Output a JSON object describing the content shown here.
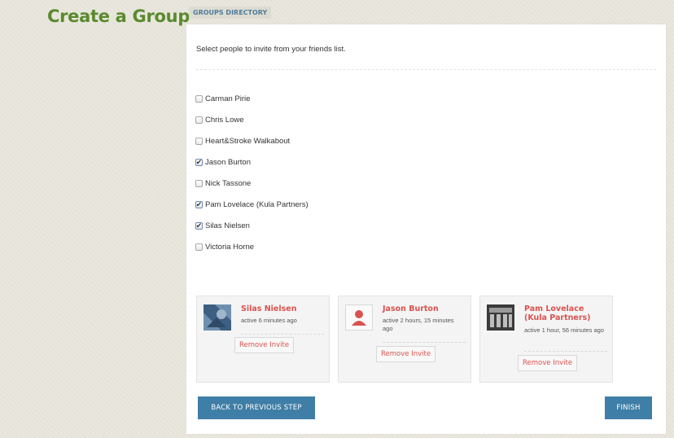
{
  "page": {
    "title": "Create a Group",
    "directory_tab": "GROUPS DIRECTORY"
  },
  "invite": {
    "instructions": "Select people to invite from your friends list.",
    "friends": [
      {
        "name": "Carman Pirie",
        "checked": false
      },
      {
        "name": "Chris Lowe",
        "checked": false
      },
      {
        "name": "Heart&Stroke Walkabout",
        "checked": false
      },
      {
        "name": "Jason Burton",
        "checked": true
      },
      {
        "name": "Nick Tassone",
        "checked": false
      },
      {
        "name": "Pam Lovelace (Kula Partners)",
        "checked": true
      },
      {
        "name": "Silas Nielsen",
        "checked": true
      },
      {
        "name": "Victoria Horne",
        "checked": false
      }
    ],
    "invited": [
      {
        "name": "Silas Nielsen",
        "activity": "active 6 minutes ago",
        "remove_label": "Remove Invite",
        "avatar": "photo-avatar"
      },
      {
        "name": "Jason Burton",
        "activity": "active 2 hours, 15 minutes ago",
        "remove_label": "Remove Invite",
        "avatar": "default-avatar"
      },
      {
        "name": "Pam Lovelace (Kula Partners)",
        "activity": "active 1 hour, 56 minutes ago",
        "remove_label": "Remove Invite",
        "avatar": "photo-avatar"
      }
    ]
  },
  "actions": {
    "back_label": "BACK TO PREVIOUS STEP",
    "finish_label": "FINISH"
  },
  "colors": {
    "title_green": "#5a8a2e",
    "name_red": "#d9534f",
    "button_blue": "#3f7ea6"
  }
}
